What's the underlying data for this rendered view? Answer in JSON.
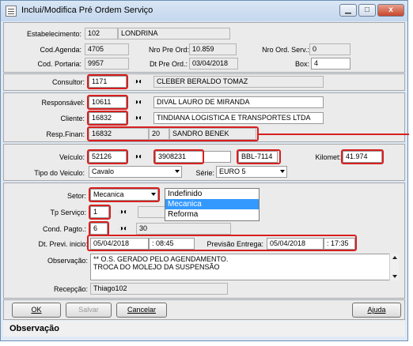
{
  "window": {
    "title": "Inclui/Modifica Pré Ordem Serviço",
    "controls": {
      "minimize": "▁",
      "maximize": "□",
      "close": "x"
    }
  },
  "header": {
    "estabelecimento_label": "Estabelecimento:",
    "estabelecimento_code": "102",
    "estabelecimento_name": "LONDRINA",
    "cod_agenda_label": "Cod.Agenda:",
    "cod_agenda": "4705",
    "nro_pre_ord_label": "Nro Pre Ord:",
    "nro_pre_ord": "10.859",
    "nro_ord_serv_label": "Nro Ord. Serv.:",
    "nro_ord_serv": "0",
    "cod_portaria_label": "Cod. Portaria:",
    "cod_portaria": "9957",
    "dt_pre_ord_label": "Dt Pre Ord.:",
    "dt_pre_ord": "03/04/2018",
    "box_label": "Box:",
    "box": "4"
  },
  "consultor": {
    "label": "Consultor:",
    "code": "1171",
    "name": "CLEBER BERALDO TOMAZ"
  },
  "people": {
    "responsavel_label": "Responsável:",
    "responsavel_code": "10611",
    "responsavel_name": "DIVAL LAURO DE MIRANDA",
    "cliente_label": "Cliente:",
    "cliente_code": "16832",
    "cliente_name": "TINDIANA LOGISTICA E TRANSPORTES LTDA",
    "resp_finan_label": "Resp.Finan:",
    "resp_finan_code": "16832",
    "resp_finan_seq": "20",
    "resp_finan_name": "SANDRO BENEK"
  },
  "vehicle": {
    "veiculo_label": "Veículo:",
    "veiculo_code": "52126",
    "chassi": "3908231",
    "placa": "BBL-7114",
    "kilomet_label": "Kilomet:",
    "kilomet": "41.974",
    "tipo_label": "Tipo do Veiculo:",
    "tipo": "Cavalo",
    "serie_label": "Série:",
    "serie": "EURO 5"
  },
  "service": {
    "setor_label": "Setor:",
    "setor": "Mecanica",
    "setor_options": [
      "Indefinido",
      "Mecanica",
      "Reforma"
    ],
    "tp_servico_label": "Tp Serviço:",
    "tp_servico": "1",
    "cond_pagto_label": "Cond. Pagto.:",
    "cond_pagto": "6",
    "cond_pagto_desc": "30",
    "dt_previ_label": "Dt. Previ. inicio:",
    "dt_previ_date": "05/04/2018",
    "dt_previ_time": "08:45",
    "previsao_label": "Previsão Entrega:",
    "previsao_date": "05/04/2018",
    "previsao_time": "17:35",
    "observacao_label": "Observação:",
    "observacao_line1": "** O.S. GERADO PELO AGENDAMENTO.",
    "observacao_line2": "TROCA DO MOLEJO DA SUSPENSÃO",
    "recepcao_label": "Recepção:",
    "recepcao": "Thiago102"
  },
  "buttons": {
    "ok": "OK",
    "salvar": "Salvar",
    "cancelar": "Cancelar",
    "ajuda": "Ajuda"
  },
  "status": {
    "text": "Observação"
  },
  "icons": {
    "search": "binoculars-icon"
  }
}
